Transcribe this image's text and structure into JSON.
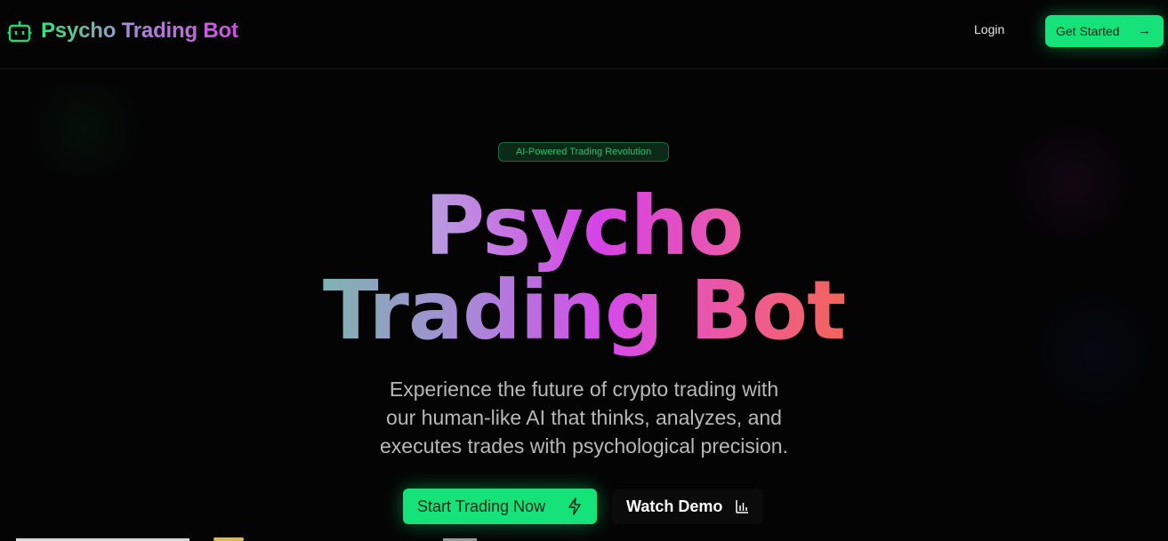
{
  "nav": {
    "brand_name": "Psycho Trading Bot",
    "brand_icon": "robot-icon",
    "login_label": "Login",
    "get_started_label": "Get Started",
    "get_started_icon": "arrow-right-icon"
  },
  "hero": {
    "badge": "AI-Powered Trading Revolution",
    "headline_line1": "Psycho",
    "headline_line2": "Trading Bot",
    "subtitle_lines": [
      "Experience the future of crypto trading with",
      "our human-like AI that thinks, analyzes, and",
      "executes trades with psychological precision."
    ],
    "primary_cta": "Start Trading Now",
    "primary_cta_icon": "lightning-icon",
    "secondary_cta": "Watch Demo",
    "secondary_cta_icon": "bar-chart-icon"
  },
  "colors": {
    "accent": "#15e37a",
    "background": "#040404"
  }
}
